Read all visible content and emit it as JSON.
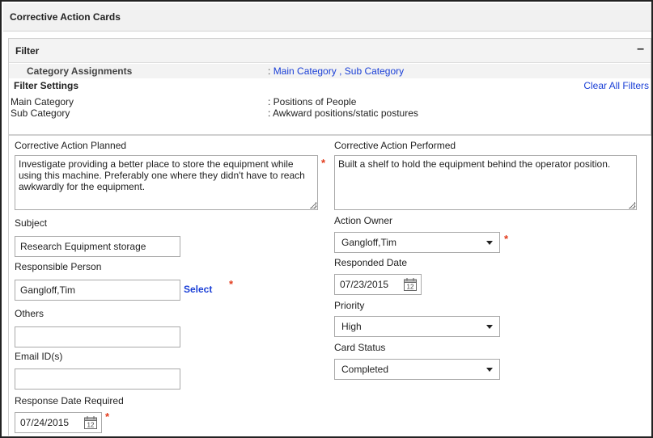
{
  "header": {
    "title": "Corrective Action Cards"
  },
  "filter": {
    "title": "Filter",
    "collapse_symbol": "–",
    "category_assignments_label": "Category Assignments",
    "category_assignments_prefix": ":",
    "main_category_link": "Main Category",
    "separator": ",",
    "sub_category_link": "Sub Category",
    "settings_label": "Filter Settings",
    "clear_all_label": "Clear All Filters",
    "settings": {
      "main_category_key": "Main Category",
      "main_category_value": ": Positions of People",
      "sub_category_key": "Sub Category",
      "sub_category_value": ": Awkward positions/static postures"
    }
  },
  "form": {
    "required_mark": "*",
    "corrective_action_planned": {
      "label": "Corrective Action Planned",
      "value": "Investigate providing a better place to store the equipment while using this machine. Preferably one where they didn't have to reach awkwardly for the equipment."
    },
    "corrective_action_performed": {
      "label": "Corrective Action Performed",
      "value": "Built a shelf to hold the equipment behind the operator position."
    },
    "subject": {
      "label": "Subject",
      "value": "Research Equipment storage"
    },
    "responsible_person": {
      "label": "Responsible Person",
      "value": "Gangloff,Tim",
      "select_label": "Select"
    },
    "others": {
      "label": "Others",
      "value": ""
    },
    "email_ids": {
      "label": "Email ID(s)",
      "value": ""
    },
    "response_date_required": {
      "label": "Response Date Required",
      "value": "07/24/2015"
    },
    "action_owner": {
      "label": "Action Owner",
      "value": "Gangloff,Tim"
    },
    "responded_date": {
      "label": "Responded Date",
      "value": "07/23/2015"
    },
    "priority": {
      "label": "Priority",
      "value": "High"
    },
    "card_status": {
      "label": "Card Status",
      "value": "Completed"
    },
    "calendar_day": "12"
  },
  "icons": {
    "calendar": "calendar-icon",
    "dropdown": "chevron-down-icon",
    "collapse": "minus-icon"
  },
  "colors": {
    "link": "#1a3fd6",
    "required": "#e23a1b",
    "header_bg": "#f1f1f1"
  }
}
